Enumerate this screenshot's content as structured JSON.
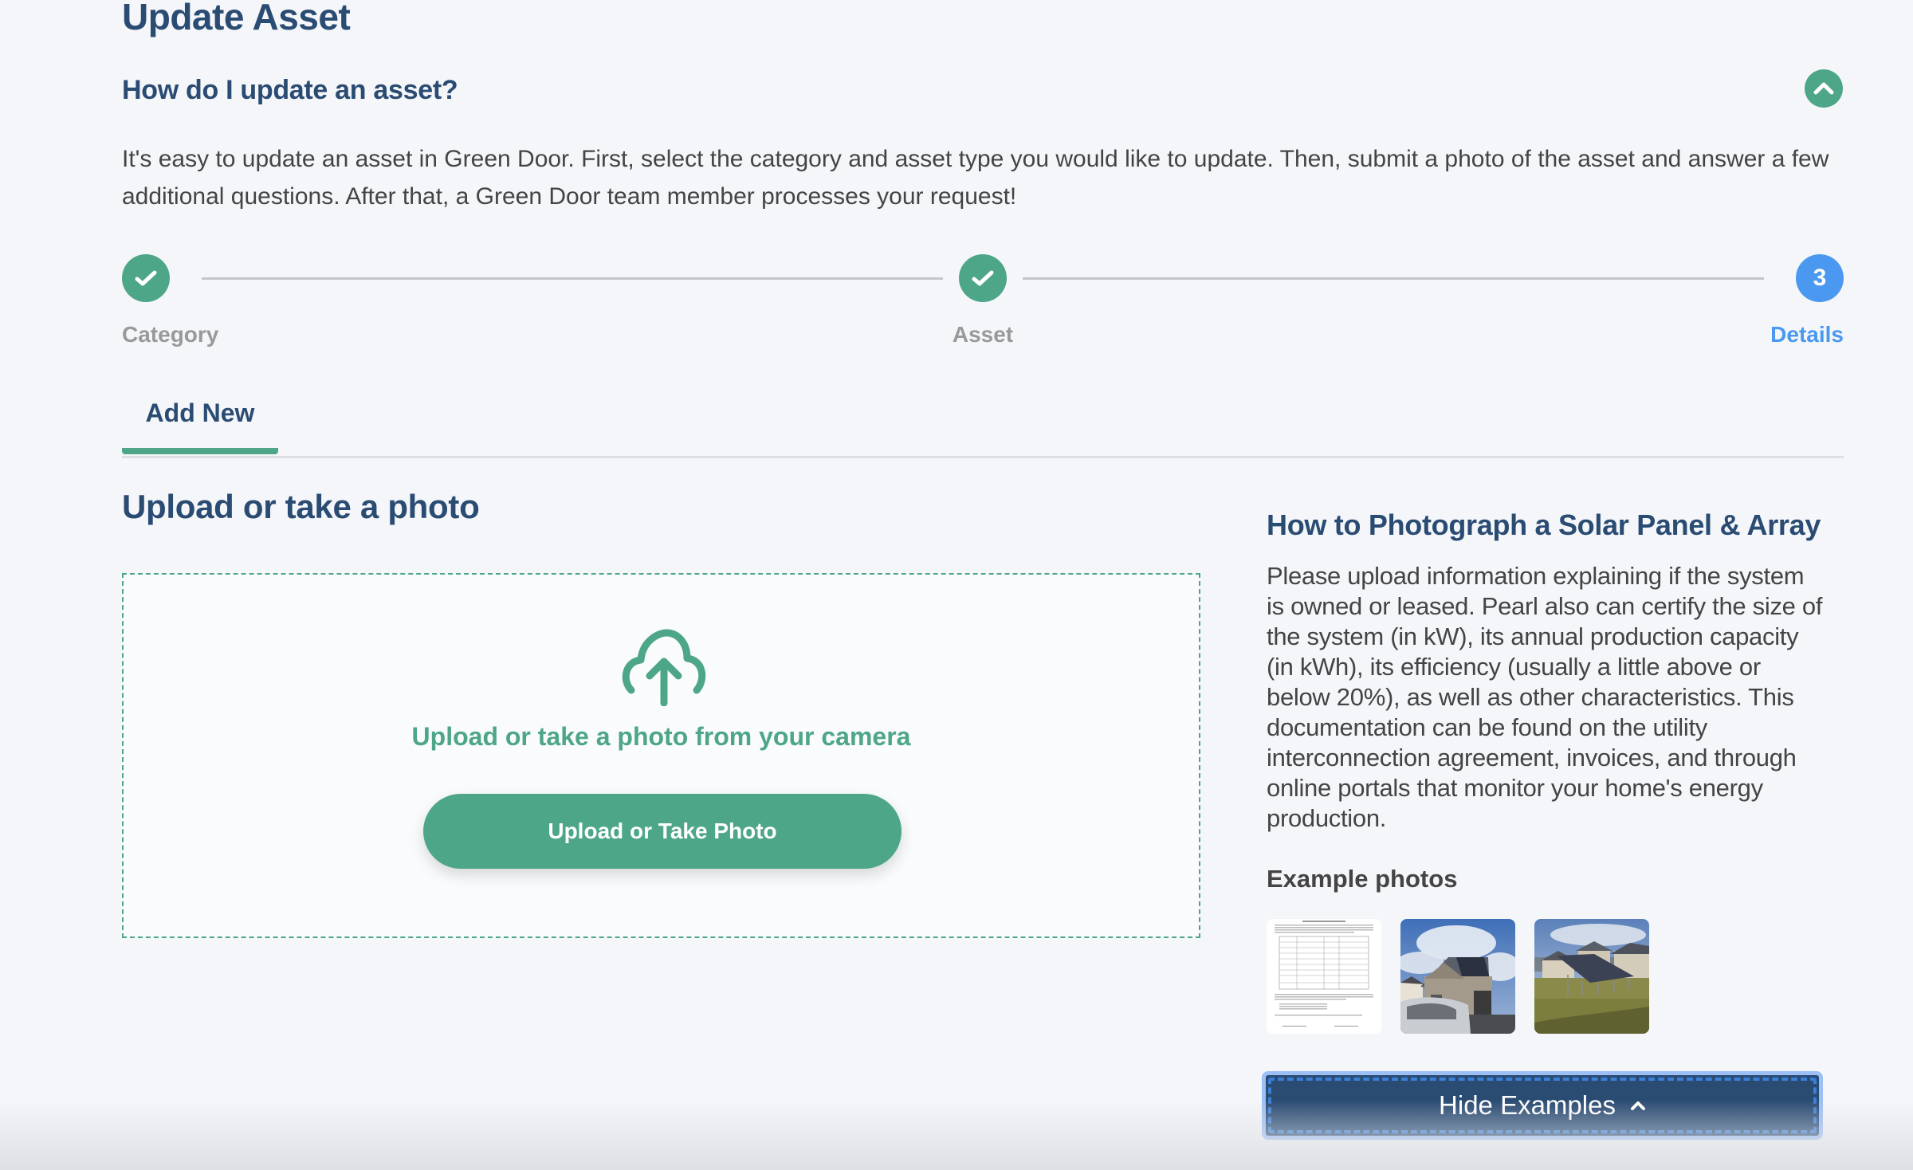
{
  "page": {
    "title": "Update Asset"
  },
  "faq": {
    "title": "How do I update an asset?",
    "body": "It's easy to update an asset in Green Door. First, select the category and asset type you would like to update. Then, submit a photo of the asset and answer a few additional questions. After that, a Green Door team member processes your request!",
    "toggle_icon": "chevron-up-icon"
  },
  "stepper": {
    "steps": [
      {
        "label": "Category",
        "status": "complete",
        "icon": "check-icon"
      },
      {
        "label": "Asset",
        "status": "complete",
        "icon": "check-icon"
      },
      {
        "label": "Details",
        "status": "active",
        "number": "3"
      }
    ]
  },
  "tabs": [
    {
      "label": "Add New",
      "active": true
    }
  ],
  "upload": {
    "title": "Upload or take a photo",
    "hint": "Upload or take a photo from your camera",
    "button_label": "Upload or Take Photo",
    "icon": "cloud-upload-icon"
  },
  "help": {
    "title": "How to Photograph a Solar Panel & Array",
    "body": "Please upload information explaining if the system is owned or leased. Pearl also can certify the size of the system (in kW), its annual production capacity (in kWh), its efficiency (usually a little above or below 20%), as well as other characteristics. This documentation can be found on the utility interconnection agreement, invoices, and through online portals that monitor your home's energy production.",
    "examples_title": "Example photos",
    "examples": [
      {
        "alt": "Solar interconnection agreement document"
      },
      {
        "alt": "House with rooftop solar panels"
      },
      {
        "alt": "Ground-mounted solar array in backyard"
      }
    ],
    "hide_button_label": "Hide Examples"
  },
  "colors": {
    "brand_green": "#4da687",
    "navy": "#2a4b72",
    "active_blue": "#4a98f0",
    "background": "#f4f6fa"
  }
}
